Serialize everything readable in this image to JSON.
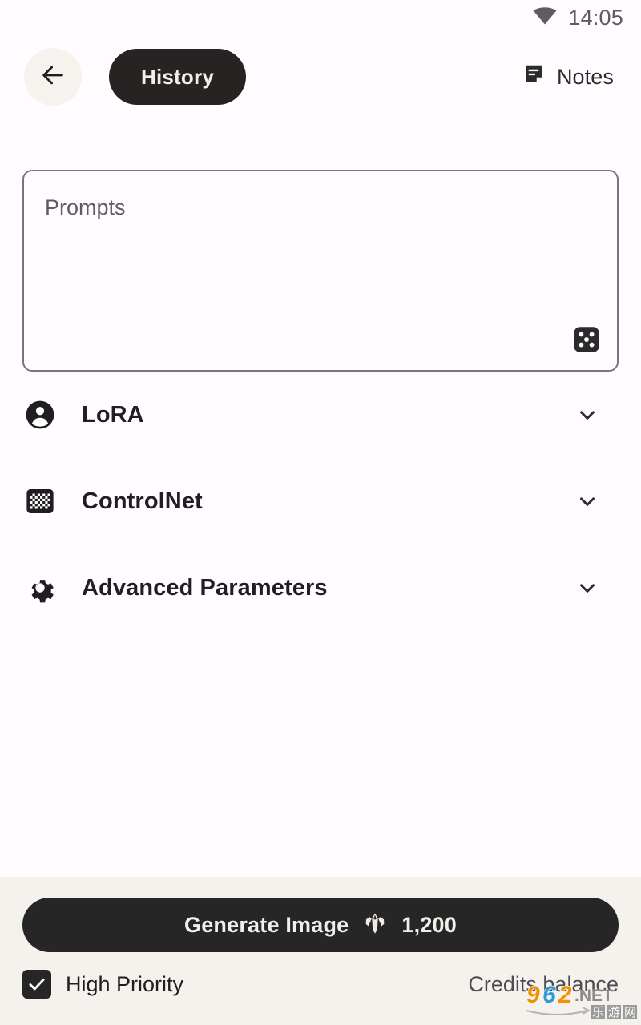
{
  "status_bar": {
    "time": "14:05",
    "wifi_icon": "wifi-icon"
  },
  "appbar": {
    "back_icon": "arrow-left-icon",
    "history_label": "History",
    "notes_label": "Notes",
    "notes_icon": "note-icon"
  },
  "prompt": {
    "placeholder": "Prompts",
    "value": "",
    "dice_icon": "dice-icon"
  },
  "sections": [
    {
      "label": "LoRA",
      "icon": "account-circle-icon",
      "expander_icon": "chevron-down-icon"
    },
    {
      "label": "ControlNet",
      "icon": "checkerboard-grid-icon",
      "expander_icon": "chevron-down-icon"
    },
    {
      "label": "Advanced Parameters",
      "icon": "gear-icon",
      "expander_icon": "chevron-down-icon"
    }
  ],
  "bottom": {
    "generate_label": "Generate Image",
    "generate_cost": "1,200",
    "gem_icon": "crystal-gem-icon",
    "high_priority_label": "High Priority",
    "high_priority_checked": true,
    "credits_balance_label": "Credits balance"
  },
  "watermark": {
    "digits": "962",
    "suffix": ".NET",
    "subtitle": "乐游网"
  },
  "colors": {
    "page_background": "#FFFBFF",
    "bottom_bar_background": "#F5F1EC",
    "accent_dark": "#262422",
    "button_dark": "#262626",
    "back_button_background": "#F6F3EF",
    "border": "#79747E",
    "placeholder_text": "#5D5C63",
    "watermark_orange": "#F29100",
    "watermark_blue": "#2E9BD6"
  }
}
